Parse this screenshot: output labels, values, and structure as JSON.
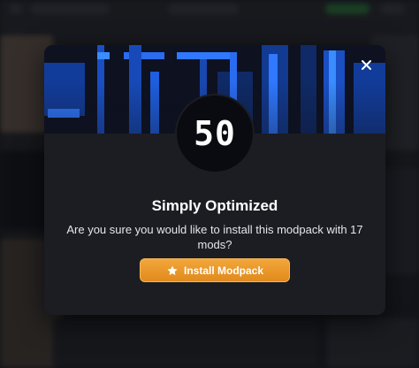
{
  "modal": {
    "title": "Simply Optimized",
    "message": "Are you sure you would like to install this modpack with 17 mods?",
    "logo_text": "50",
    "close_icon": "close-icon",
    "install_button": {
      "label": "Install Modpack",
      "icon": "star-icon"
    }
  },
  "colors": {
    "accent": "#e8951f",
    "modal_bg": "#1c1d22",
    "banner_blue": "#1f5fd6"
  }
}
